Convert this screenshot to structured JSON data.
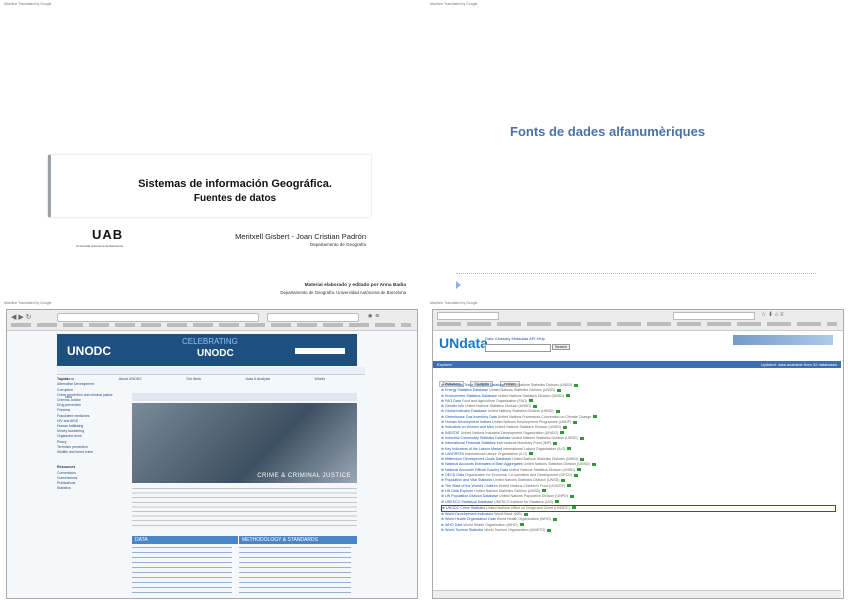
{
  "machine_translated": "Machine Translated by Google",
  "slide1": {
    "title": "Sistemas de información Geográfica.",
    "subtitle": "Fuentes de datos",
    "logo": "UAB",
    "logo_sub": "Universitat Autònoma de Barcelona",
    "authors": "Meritxell Gisbert - Joan Cristian Padrón",
    "department": "Departamento de Geografía",
    "credit_line1": "Material elaborado y editado por Anna Badia",
    "credit_line2": "Departamento de Geografía. Universidad Autónoma de Barcelona"
  },
  "slide2": {
    "title": "Fonts de dades alfanumèriques"
  },
  "unodc": {
    "logo": "UNODC",
    "celebrating": "CELEBRATING",
    "nav": [
      "Home",
      "About UNODC",
      "Our Work",
      "Data & Analysis",
      "What's New"
    ],
    "banner": "CRIME & CRIMINAL JUSTICE",
    "sidebar_h1": "Topics",
    "sidebar_items": [
      "Alternative Development",
      "Corruption",
      "Crime prevention and criminal justice",
      "Criminal Justice",
      "Drug prevention",
      "Firearms",
      "Fraudulent medicines",
      "HIV and AIDS",
      "Human trafficking",
      "Money laundering",
      "Organized crime",
      "Piracy",
      "Terrorism prevention",
      "Wildlife and forest crime"
    ],
    "sidebar_h2": "Resources",
    "sidebar_items2": [
      "Conventions",
      "Commissions",
      "Publications",
      "Statistics"
    ],
    "data_heading": "DATA",
    "methodology_heading": "METHODOLOGY & STANDARDS"
  },
  "undata": {
    "logo": "UNdata",
    "menu": [
      "Data",
      "Glossary",
      "Metadata",
      "API",
      "Help"
    ],
    "search_label": "Search",
    "bar_left": "Explorer",
    "bar_right": "Updated: data available from 32 databases",
    "tabs": [
      "Databases",
      "Countries",
      "Indexes"
    ],
    "databases": [
      {
        "name": "Commodity Trade Statistics Database",
        "src": "United Nations Statistics Division (UNSD)"
      },
      {
        "name": "Energy Statistics Database",
        "src": "United Nations Statistics Division (UNSD)"
      },
      {
        "name": "Environment Statistics Database",
        "src": "United Nations Statistics Division (UNSD)"
      },
      {
        "name": "FAO Data",
        "src": "Food and Agriculture Organization (FAO)"
      },
      {
        "name": "Gender Info",
        "src": "United Nations Statistics Division (UNSD)"
      },
      {
        "name": "Global Indicator Database",
        "src": "United Nations Statistics Division (UNSD)"
      },
      {
        "name": "Greenhouse Gas Inventory Data",
        "src": "United Nations Framework Convention on Climate Change"
      },
      {
        "name": "Human Development Indices",
        "src": "United Nations Development Programme (UNDP)"
      },
      {
        "name": "Indicators on Women and Men",
        "src": "United Nations Statistics Division (UNSD)"
      },
      {
        "name": "INDSTAT",
        "src": "United Nations Industrial Development Organization (UNIDO)"
      },
      {
        "name": "Industrial Commodity Statistics Database",
        "src": "United Nations Statistics Division (UNSD)"
      },
      {
        "name": "International Financial Statistics",
        "src": "International Monetary Fund (IMF)"
      },
      {
        "name": "Key Indicators of the Labour Market",
        "src": "International Labour Organization (ILO)"
      },
      {
        "name": "LABORSTA",
        "src": "International Labour Organization (ILO)"
      },
      {
        "name": "Millennium Development Goals Database",
        "src": "United Nations Statistics Division (UNSD)"
      },
      {
        "name": "National Accounts Estimates of Main Aggregates",
        "src": "United Nations Statistics Division (UNSD)"
      },
      {
        "name": "National Accounts Official Country Data",
        "src": "United Nations Statistics Division (UNSD)"
      },
      {
        "name": "OECD Data",
        "src": "Organisation for Economic Co-operation and Development (OECD)"
      },
      {
        "name": "Population and Vital Statistics",
        "src": "United Nations Statistics Division (UNSD)"
      },
      {
        "name": "The State of the World's Children",
        "src": "United Nations Children's Fund (UNICEF)"
      },
      {
        "name": "UN Data Explorer",
        "src": "United Nations Statistics Division (UNSD)"
      },
      {
        "name": "UN Population Division Database",
        "src": "United Nations Population Division (UNPD)"
      },
      {
        "name": "UNESCO Statistical Database",
        "src": "UNESCO Institute for Statistics (UIS)"
      },
      {
        "name": "UNODC Crime Statistics",
        "src": "United Nations Office on Drugs and Crime (UNODC)"
      },
      {
        "name": "World Development Indicators",
        "src": "World Bank (WB)"
      },
      {
        "name": "World Health Organization Data",
        "src": "World Health Organization (WHO)"
      },
      {
        "name": "WHO Data",
        "src": "World Health Organization (WHO)"
      },
      {
        "name": "World Tourism Statistics",
        "src": "World Tourism Organization (UNWTO)"
      }
    ],
    "highlight_index": 23
  }
}
